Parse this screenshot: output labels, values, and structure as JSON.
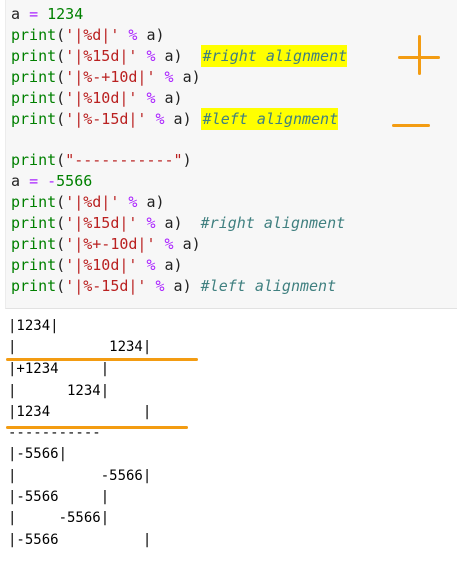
{
  "code_lines": [
    [
      [
        "a ",
        ""
      ],
      [
        "=",
        "op"
      ],
      [
        " ",
        ""
      ],
      [
        "1234",
        "num"
      ]
    ],
    [
      [
        "print",
        "fn"
      ],
      [
        "(",
        ""
      ],
      [
        "'|%d|'",
        "str"
      ],
      [
        " ",
        ""
      ],
      [
        "%",
        "op"
      ],
      [
        " a)",
        ""
      ]
    ],
    [
      [
        "print",
        "fn"
      ],
      [
        "(",
        ""
      ],
      [
        "'|%15d|'",
        "str"
      ],
      [
        " ",
        ""
      ],
      [
        "%",
        "op"
      ],
      [
        " a)",
        ""
      ],
      [
        "  ",
        ""
      ],
      [
        "#right alignment",
        "cm hl"
      ]
    ],
    [
      [
        "print",
        "fn"
      ],
      [
        "(",
        ""
      ],
      [
        "'|%-+10d|'",
        "str"
      ],
      [
        " ",
        ""
      ],
      [
        "%",
        "op"
      ],
      [
        " a)",
        ""
      ]
    ],
    [
      [
        "print",
        "fn"
      ],
      [
        "(",
        ""
      ],
      [
        "'|%10d|'",
        "str"
      ],
      [
        " ",
        ""
      ],
      [
        "%",
        "op"
      ],
      [
        " a)",
        ""
      ]
    ],
    [
      [
        "print",
        "fn"
      ],
      [
        "(",
        ""
      ],
      [
        "'|%-15d|'",
        "str"
      ],
      [
        " ",
        ""
      ],
      [
        "%",
        "op"
      ],
      [
        " a)",
        ""
      ],
      [
        " ",
        ""
      ],
      [
        "#left alignment",
        "cm hl"
      ]
    ],
    [],
    [
      [
        "print",
        "fn"
      ],
      [
        "(",
        ""
      ],
      [
        "\"-----------\"",
        "str"
      ],
      [
        ")",
        ""
      ]
    ],
    [
      [
        "a ",
        ""
      ],
      [
        "=",
        "op"
      ],
      [
        " ",
        ""
      ],
      [
        "-",
        "op"
      ],
      [
        "5566",
        "num"
      ]
    ],
    [
      [
        "print",
        "fn"
      ],
      [
        "(",
        ""
      ],
      [
        "'|%d|'",
        "str"
      ],
      [
        " ",
        ""
      ],
      [
        "%",
        "op"
      ],
      [
        " a)",
        ""
      ]
    ],
    [
      [
        "print",
        "fn"
      ],
      [
        "(",
        ""
      ],
      [
        "'|%15d|'",
        "str"
      ],
      [
        " ",
        ""
      ],
      [
        "%",
        "op"
      ],
      [
        " a)",
        ""
      ],
      [
        "  ",
        ""
      ],
      [
        "#right alignment",
        "cm"
      ]
    ],
    [
      [
        "print",
        "fn"
      ],
      [
        "(",
        ""
      ],
      [
        "'|%+-10d|'",
        "str"
      ],
      [
        " ",
        ""
      ],
      [
        "%",
        "op"
      ],
      [
        " a)",
        ""
      ]
    ],
    [
      [
        "print",
        "fn"
      ],
      [
        "(",
        ""
      ],
      [
        "'|%10d|'",
        "str"
      ],
      [
        " ",
        ""
      ],
      [
        "%",
        "op"
      ],
      [
        " a)",
        ""
      ]
    ],
    [
      [
        "print",
        "fn"
      ],
      [
        "(",
        ""
      ],
      [
        "'|%-15d|'",
        "str"
      ],
      [
        " ",
        ""
      ],
      [
        "%",
        "op"
      ],
      [
        " a)",
        ""
      ],
      [
        " ",
        ""
      ],
      [
        "#left alignment",
        "cm"
      ]
    ]
  ],
  "output_lines": [
    "|1234|",
    "|           1234|",
    "|+1234     |",
    "|      1234|",
    "|1234           |",
    "-----------",
    "|-5566|",
    "|          -5566|",
    "|-5566     |",
    "|     -5566|",
    "|-5566          |"
  ],
  "annotation_colors": {
    "highlight": "#ffff00",
    "pen": "#f39c12"
  }
}
